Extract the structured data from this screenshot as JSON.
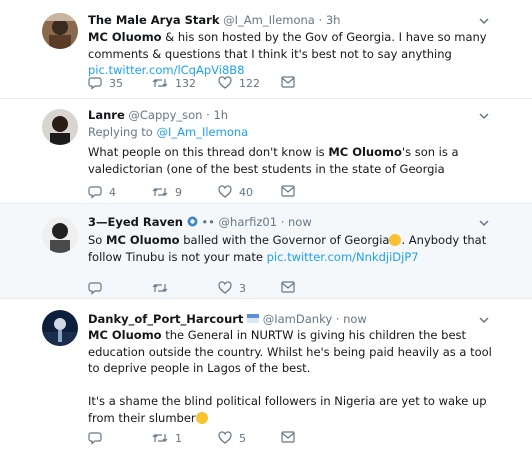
{
  "tweets": [
    {
      "name": "The Male Arya Stark",
      "handle": "@I_Am_Ilemona",
      "time": "3h",
      "body_bold": "MC Oluomo",
      "body_rest": " & his son hosted by the Gov of Georgia. I have so many comments & questions that I think it's best not to say anything ",
      "link": "pic.twitter.com/lCqApVi8B8",
      "replies": "35",
      "retweets": "132",
      "likes": "122"
    },
    {
      "name": "Lanre",
      "handle": "@Cappy_son",
      "time": "1h",
      "replying_label": "Replying to ",
      "replying_handle": "@I_Am_Ilemona",
      "body_pre": "What people on this thread don't know is ",
      "body_bold": "MC Oluomo",
      "body_rest": "'s son is a valedictorian (one of the best students in the state of Georgia",
      "replies": "4",
      "retweets": "9",
      "likes": "40"
    },
    {
      "name": "3—Eyed Raven",
      "handle": "@harfiz01",
      "time": "now",
      "body_pre": "So ",
      "body_bold": "MC Oluomo",
      "body_rest": " balled with the Governor of Georgia",
      "body_rest2": ". Anybody that follow Tinubu is not your mate ",
      "link": "pic.twitter.com/NnkdjiDjP7",
      "replies": "",
      "retweets": "",
      "likes": "3"
    },
    {
      "name": "Danky_of_Port_Harcourt",
      "handle": "@IamDanky",
      "time": "now",
      "body_bold": "MC Oluomo",
      "body_rest": " the General in NURTW is giving his children the best education outside the country. Whilst he's  being paid heavily as a tool to deprive people in Lagos of the best.",
      "body_p2": "It's a shame the blind political followers in Nigeria are yet to wake up from their slumber",
      "replies": "",
      "retweets": "1",
      "likes": "5"
    }
  ],
  "separators": {
    "dot": "·",
    "dots": "••"
  },
  "colors": {
    "link": "#1da1f2",
    "secondary_text": "#657786",
    "highlight_bg": "#f5f8fa",
    "divider": "#e6ecf0"
  },
  "icons": [
    "reply-icon",
    "retweet-icon",
    "like-icon",
    "dm-icon",
    "caret-down-icon"
  ]
}
